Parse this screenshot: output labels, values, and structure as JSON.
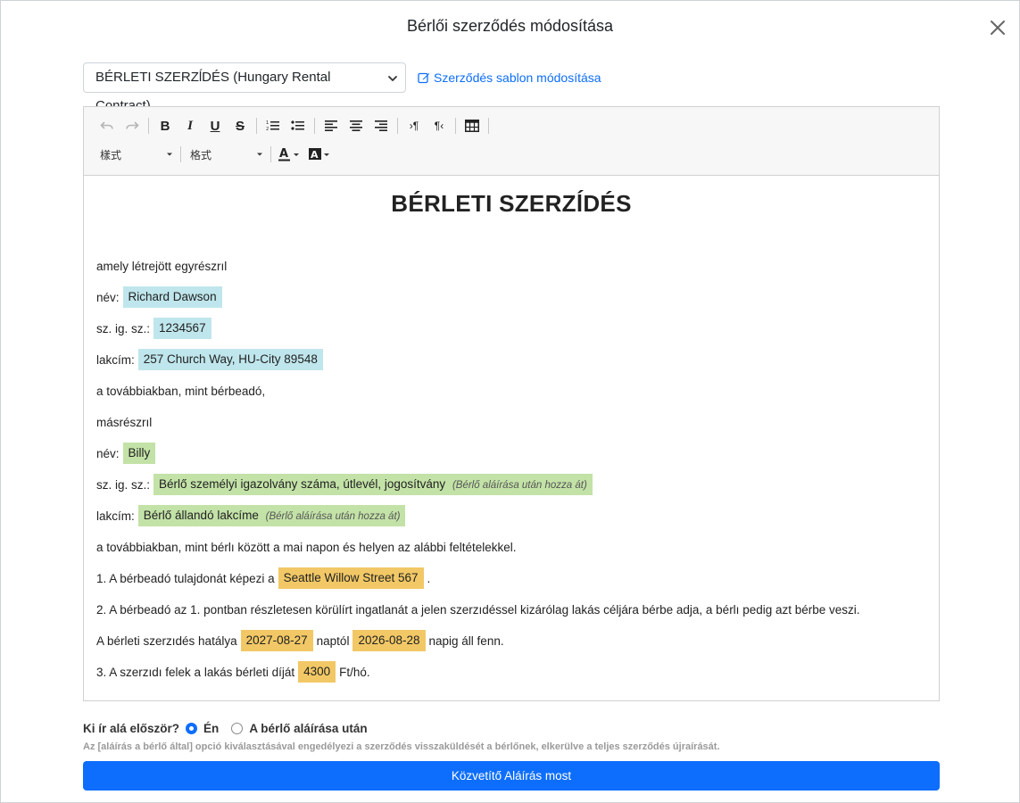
{
  "modal": {
    "title": "Bérlői szerződés módosítása",
    "close_icon": "close-icon"
  },
  "template": {
    "selected": "BÉRLETI SZERZĺDÉS (Hungary Rental Contract)",
    "edit_link": "Szerződés sablon módosítása"
  },
  "toolbar": {
    "style_dropdown": "樣式",
    "format_dropdown": "格式",
    "icons": [
      "undo-icon",
      "redo-icon",
      "bold-icon",
      "italic-icon",
      "underline-icon",
      "strikethrough-icon",
      "ordered-list-icon",
      "bullet-list-icon",
      "align-left-icon",
      "align-center-icon",
      "align-right-icon",
      "ltr-icon",
      "rtl-icon",
      "table-icon",
      "text-color-icon",
      "background-color-icon"
    ]
  },
  "document": {
    "title": "BÉRLETI SZERZĺDÉS",
    "l1": "amely létrejött egyrészrıl",
    "landlord": {
      "name_label": "név:",
      "name": "Richard Dawson",
      "id_label": "sz. ig. sz.:",
      "id": "1234567",
      "address_label": "lakcím:",
      "address": "257 Church Way, HU-City 89548"
    },
    "l2": "a továbbiakban, mint bérbeadó,",
    "l3": "másrészrıl",
    "tenant": {
      "name_label": "név:",
      "name": "Billy",
      "id_label": "sz. ig. sz.:",
      "id": "Bérlő személyi igazolvány száma, útlevél, jogosítvány",
      "id_note": "(Bérlő aláírása után hozza át)",
      "address_label": "lakcím:",
      "address": "Bérlő állandó lakcíme",
      "address_note": "(Bérlő aláírása után hozza át)"
    },
    "l4": "a továbbiakban, mint bérlı között a mai napon és helyen az alábbi feltételekkel.",
    "p1_pre": "1. A bérbeadó tulajdonát képezi a",
    "p1_property": "Seattle Willow Street 567",
    "p1_post": ".",
    "p2": "2. A bérbeadó az 1. pontban részletesen körülírt ingatlanát a jelen szerzıdéssel kizárólag lakás céljára bérbe adja, a bérlı pedig azt bérbe veszi.",
    "term_pre": "A bérleti szerzıdés hatálya",
    "term_from": "2027-08-27",
    "term_mid": "naptól",
    "term_to": "2026-08-28",
    "term_post": "napig áll fenn.",
    "p3_pre": "3. A szerzıdı felek a lakás bérleti díját",
    "p3_rent": "4300",
    "p3_post": "Ft/hó."
  },
  "footer": {
    "question": "Ki ír alá először?",
    "option_me": "Én",
    "option_after": "A bérlő aláírása után",
    "selected_option": "Én",
    "help": "Az [aláírás a bérlő által] opció kiválasztásával engedélyezi a szerződés visszaküldését a bérlőnek, elkerülve a teljes szerződés újraírását.",
    "submit": "Közvetítő Aláírás most"
  },
  "colors": {
    "primary": "#0d6efd",
    "landlord_highlight": "#bfe6ec",
    "tenant_highlight": "#c3e2a7",
    "property_highlight": "#f2c866"
  }
}
